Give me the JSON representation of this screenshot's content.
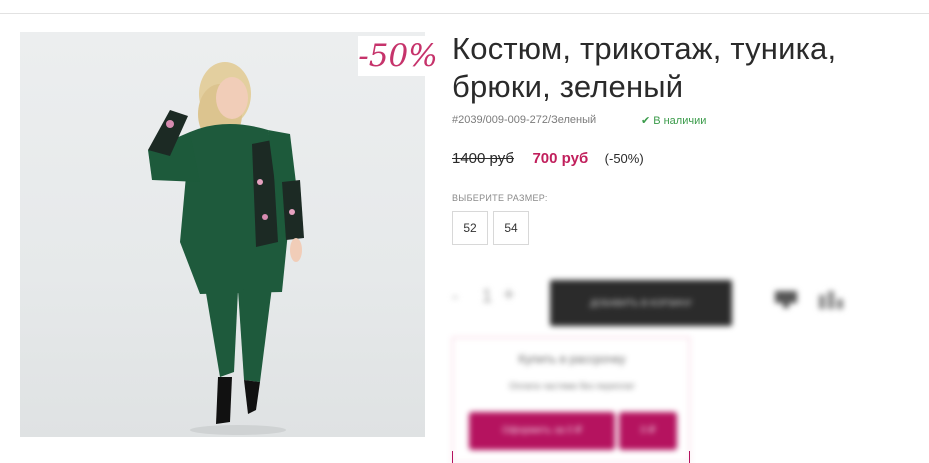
{
  "product": {
    "title": "Костюм, трикотаж, туника, брюки, зеленый",
    "discount_badge": "-50%",
    "sku": "#2039/009-009-272/Зеленый",
    "stock": "В наличии",
    "old_price": "1400 руб",
    "new_price": "700 руб",
    "discount_percent": "(-50%)",
    "image_icon": "product-photo"
  },
  "sizes": {
    "label": "ВЫБЕРИТЕ РАЗМЕР:",
    "options": [
      "52",
      "54"
    ]
  },
  "purchase": {
    "qty_minus": "-",
    "quantity": "1",
    "qty_plus": "+",
    "add_to_cart": "ДОБАВИТЬ В КОРЗИНУ",
    "favorite_icon": "heart-icon",
    "compare_icon": "compare-icon"
  },
  "credit": {
    "title": "Купить в рассрочку",
    "subtitle": "Оплата частями без переплат",
    "button": "Оформить за 0 ₽",
    "button2": "0 ₽"
  },
  "colors": {
    "accent": "#c11f5c",
    "stock_green": "#3a9b4a",
    "dark_button": "#2b2b2b"
  }
}
